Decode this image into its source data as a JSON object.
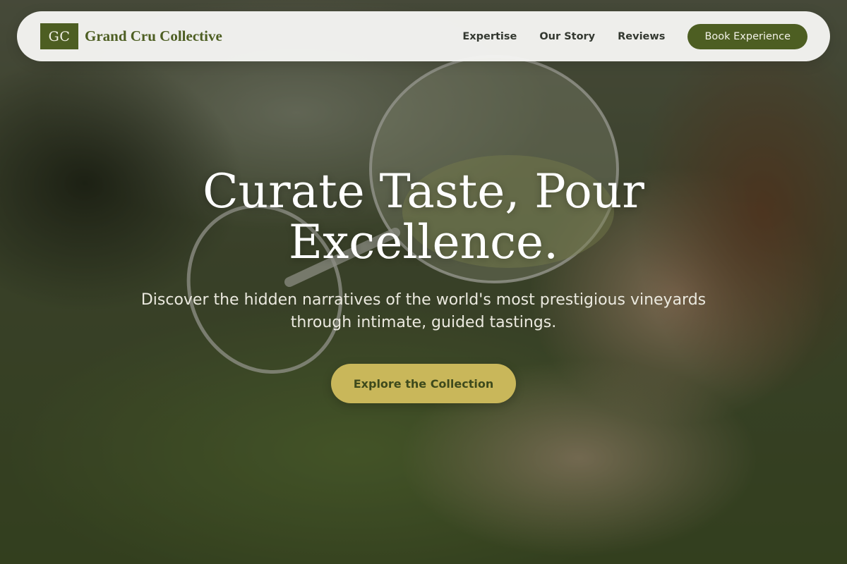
{
  "brand": {
    "logo_text": "GC",
    "name": "Grand Cru Collective"
  },
  "nav": {
    "links": [
      "Expertise",
      "Our Story",
      "Reviews"
    ],
    "cta_label": "Book Experience"
  },
  "hero": {
    "title": "Curate Taste, Pour Excellence.",
    "subtitle": "Discover the hidden narratives of the world's most prestigious vineyards through intimate, guided tastings.",
    "cta_label": "Explore the Collection"
  },
  "colors": {
    "brand_green": "#4d5e22",
    "gold_accent": "#c9b75a",
    "navbar_bg": "#f4f4f2"
  }
}
